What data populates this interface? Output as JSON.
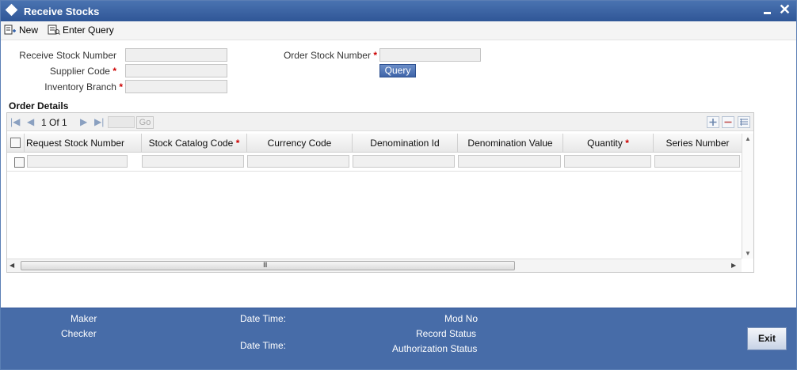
{
  "window": {
    "title": "Receive Stocks"
  },
  "toolbar": {
    "new_label": "New",
    "enter_query_label": "Enter Query"
  },
  "form": {
    "receive_stock_number": {
      "label": "Receive Stock Number",
      "value": ""
    },
    "supplier_code": {
      "label": "Supplier Code",
      "value": ""
    },
    "inventory_branch": {
      "label": "Inventory Branch",
      "value": ""
    },
    "order_stock_number": {
      "label": "Order Stock Number",
      "value": ""
    },
    "query_button": "Query",
    "required_mark": "*"
  },
  "order_details": {
    "title": "Order Details",
    "pagination": {
      "current": "1",
      "of_label": "Of",
      "total": "1",
      "go_label": "Go"
    },
    "columns": [
      {
        "label": "Request Stock Number",
        "required": false
      },
      {
        "label": "Stock Catalog Code",
        "required": true
      },
      {
        "label": "Currency Code",
        "required": false
      },
      {
        "label": "Denomination Id",
        "required": false
      },
      {
        "label": "Denomination Value",
        "required": false
      },
      {
        "label": "Quantity",
        "required": true
      },
      {
        "label": "Series Number",
        "required": false
      }
    ],
    "scroll_grip": "III"
  },
  "footer": {
    "maker": "Maker",
    "checker": "Checker",
    "date_time_1": "Date Time:",
    "date_time_2": "Date Time:",
    "mod_no": "Mod No",
    "record_status": "Record Status",
    "authorization_status": "Authorization Status",
    "exit_label": "Exit"
  },
  "colors": {
    "titlebar": "#2f5697",
    "footer": "#476ca8",
    "required": "#cc0000"
  }
}
